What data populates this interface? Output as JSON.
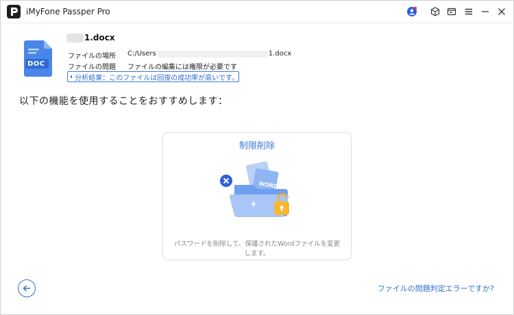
{
  "window": {
    "title": "iMyFone Passper Pro"
  },
  "file": {
    "name": "1.docx",
    "doc_badge": "DOC",
    "location_label": "ファイルの場所",
    "location_value_prefix": "C:/Users",
    "location_value_suffix": "1.docx",
    "issue_label": "ファイルの問題",
    "issue_value": "ファイルの編集には権限が必要です",
    "analysis": "分析結果：このファイルは回復の成功率が高いです。"
  },
  "recommend_text": "以下の機能を使用することをおすすめします：",
  "card": {
    "title": "制限削除",
    "description": "パスワードを削除して、保護されたWordファイルを変更します。"
  },
  "footer": {
    "help_link": "ファイルの問題判定エラーですか?"
  },
  "colors": {
    "accent": "#2f6fd1",
    "user_icon": "#2d5be3",
    "user_badge": "#e0353b",
    "doc_blue": "#4a86e8"
  }
}
